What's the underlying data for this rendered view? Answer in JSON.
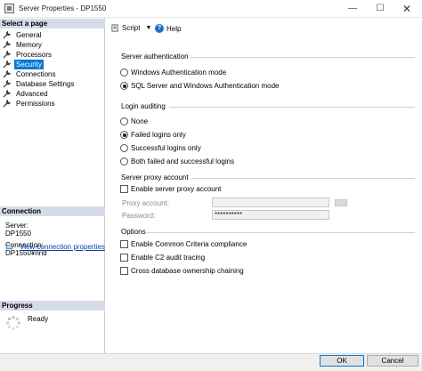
{
  "window": {
    "title": "Server Properties - DP1550",
    "minimize": "—",
    "maximize": "☐",
    "close": "✕"
  },
  "left": {
    "select_page_header": "Select a page",
    "pages": [
      {
        "label": "General",
        "selected": false
      },
      {
        "label": "Memory",
        "selected": false
      },
      {
        "label": "Processors",
        "selected": false
      },
      {
        "label": "Security",
        "selected": true
      },
      {
        "label": "Connections",
        "selected": false
      },
      {
        "label": "Database Settings",
        "selected": false
      },
      {
        "label": "Advanced",
        "selected": false
      },
      {
        "label": "Permissions",
        "selected": false
      }
    ],
    "connection_header": "Connection",
    "server_label": "Server:",
    "server_value": "DP1550",
    "connection_label": "Connection:",
    "connection_value": "DP1550¥nrid",
    "view_connection_link": "View connection properties",
    "progress_header": "Progress",
    "progress_status": "Ready"
  },
  "toolbar": {
    "script_label": "Script",
    "help_label": "Help"
  },
  "server_auth": {
    "title": "Server authentication",
    "options": [
      {
        "label": "Windows Authentication mode",
        "checked": false
      },
      {
        "label": "SQL Server and Windows Authentication mode",
        "checked": true
      }
    ]
  },
  "login_auditing": {
    "title": "Login auditing",
    "options": [
      {
        "label": "None",
        "checked": false
      },
      {
        "label": "Failed logins only",
        "checked": true
      },
      {
        "label": "Successful logins only",
        "checked": false
      },
      {
        "label": "Both failed and successful logins",
        "checked": false
      }
    ]
  },
  "proxy": {
    "title": "Server proxy account",
    "enable_label": "Enable server proxy account",
    "enable_checked": false,
    "account_label": "Proxy account:",
    "account_value": "",
    "password_label": "Password:",
    "password_value": "**********"
  },
  "options": {
    "title": "Options",
    "items": [
      {
        "label": "Enable Common Criteria compliance",
        "checked": false
      },
      {
        "label": "Enable C2 audit tracing",
        "checked": false
      },
      {
        "label": "Cross database ownership chaining",
        "checked": false
      }
    ]
  },
  "buttons": {
    "ok": "OK",
    "cancel": "Cancel"
  }
}
